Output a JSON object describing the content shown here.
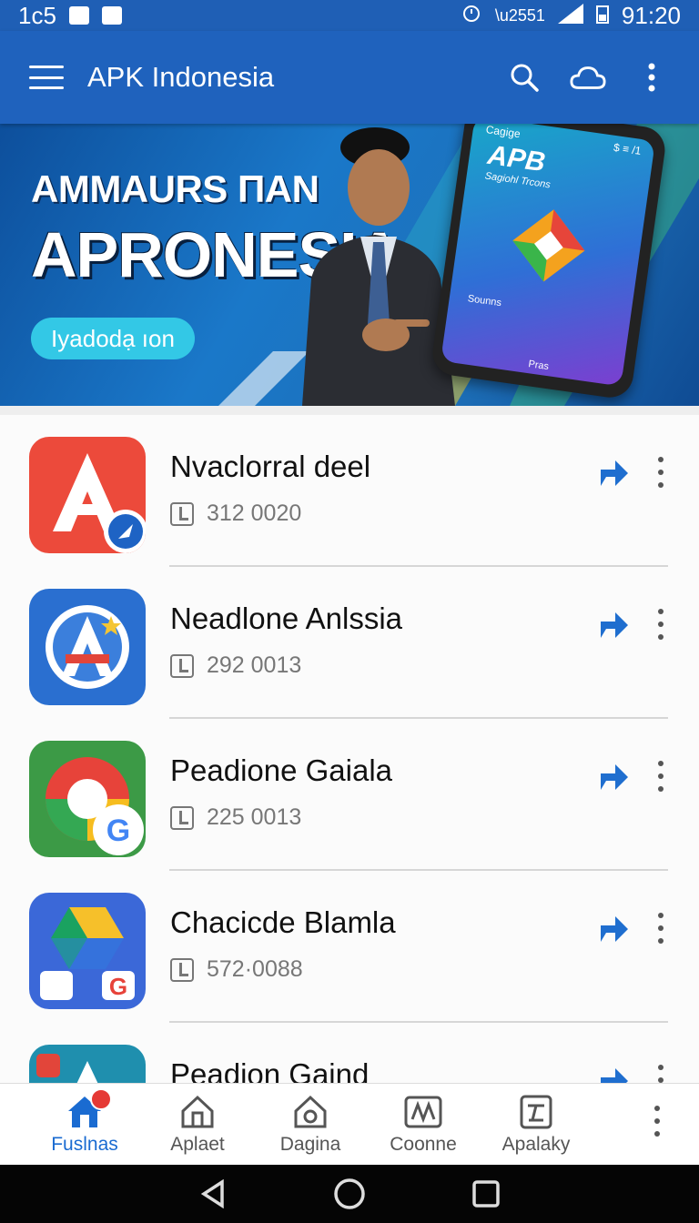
{
  "status_bar": {
    "left_text": "1c5",
    "time": "91:20",
    "right_text": "$$"
  },
  "app_bar": {
    "title": "APK Indonesia",
    "icons": [
      "menu-icon",
      "search-icon",
      "cloud-icon",
      "more-vert-icon"
    ]
  },
  "banner": {
    "line1": "AMMAURS ΠAN",
    "line2": "APRONESIA",
    "button_label": "Iyadodạ ıon",
    "phone": {
      "top_left": "Cagige",
      "top_right": "$ ≡ /1",
      "title": "APB",
      "subtitle": "Sagiohl Trcons",
      "foot": "Sounns",
      "foot2": "Pras"
    }
  },
  "apps": [
    {
      "name": "Nvaclorral deel",
      "count": "312 0020",
      "icon": "red-a-icon"
    },
    {
      "name": "Neadlone Anlssia",
      "count": "292 0013",
      "icon": "blue-a-icon"
    },
    {
      "name": "Peadione Gaiala",
      "count": "225 0013",
      "icon": "google-g-icon"
    },
    {
      "name": "Chacicde Blamla",
      "count": "572·0088",
      "icon": "drive-icon"
    },
    {
      "name": "Peadion Gaind",
      "count": "",
      "icon": "partial-app-icon"
    }
  ],
  "bottom_nav": [
    {
      "label": "Fuslnas",
      "active": true
    },
    {
      "label": "Aplaet",
      "active": false
    },
    {
      "label": "Dagina",
      "active": false
    },
    {
      "label": "Coonne",
      "active": false
    },
    {
      "label": "Apalaky",
      "active": false
    }
  ],
  "colors": {
    "primary": "#1f62bd",
    "accent": "#33c8e6",
    "active_nav": "#1a6bd1"
  }
}
